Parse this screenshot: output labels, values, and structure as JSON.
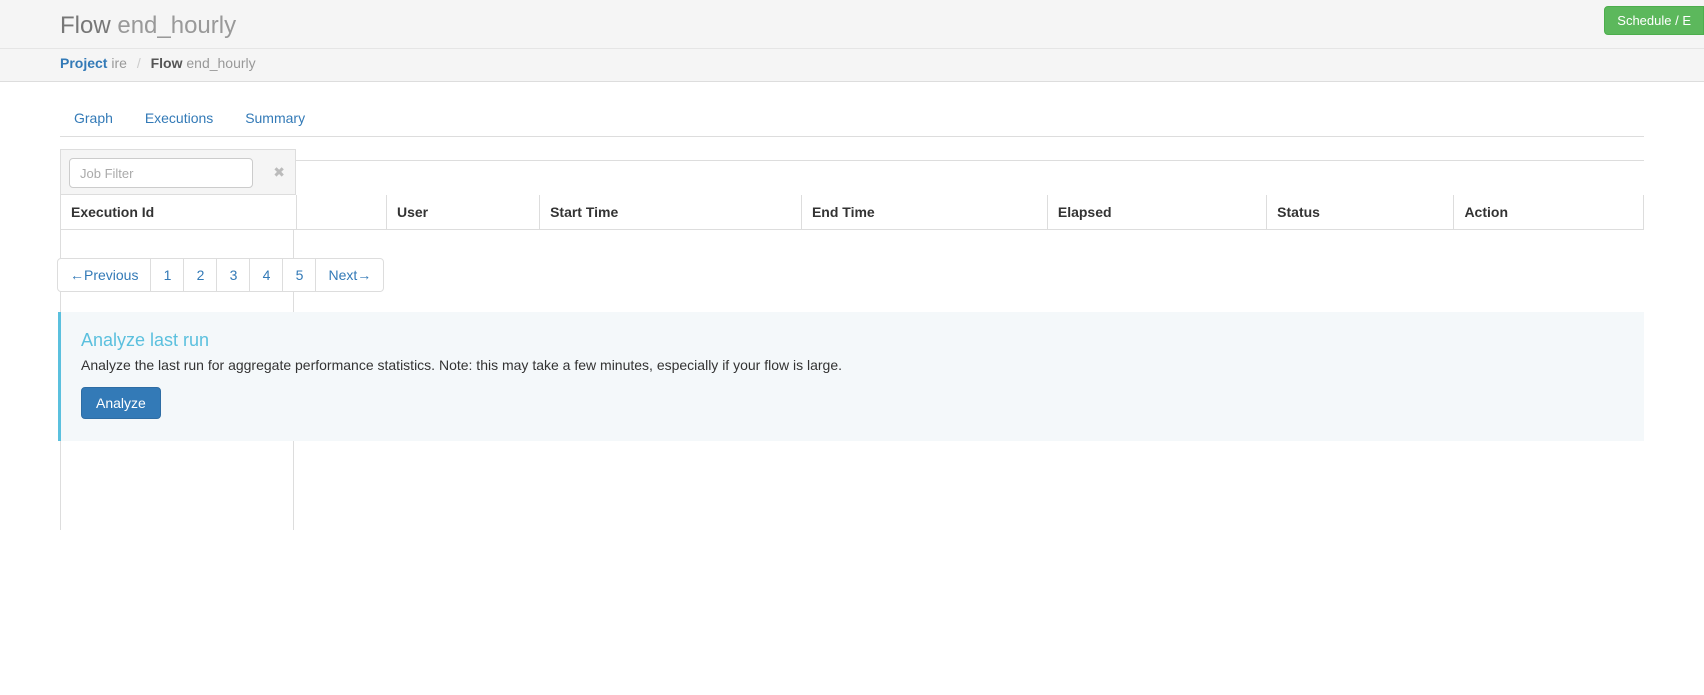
{
  "header": {
    "title_prefix": "Flow",
    "title_suffix": "end_hourly",
    "schedule_label": "Schedule / E"
  },
  "breadcrumb": {
    "project_label": "Project",
    "project_name": "ire",
    "flow_label": "Flow",
    "flow_name": "end_hourly"
  },
  "tabs": {
    "graph": "Graph",
    "executions": "Executions",
    "summary": "Summary"
  },
  "filter": {
    "placeholder": "Job Filter",
    "clear_icon": "✖"
  },
  "table": {
    "columns": {
      "exec_id": "Execution Id",
      "user": "User",
      "start": "Start Time",
      "end": "End Time",
      "elapsed": "Elapsed",
      "status": "Status",
      "action": "Action"
    }
  },
  "pagination": {
    "prev": "←Previous",
    "pages": [
      "1",
      "2",
      "3",
      "4",
      "5"
    ],
    "next": "Next→"
  },
  "callout": {
    "title": "Analyze last run",
    "body": "Analyze the last run for aggregate performance statistics. Note: this may take a few minutes, especially if your flow is large.",
    "button_label": "Analyze"
  }
}
